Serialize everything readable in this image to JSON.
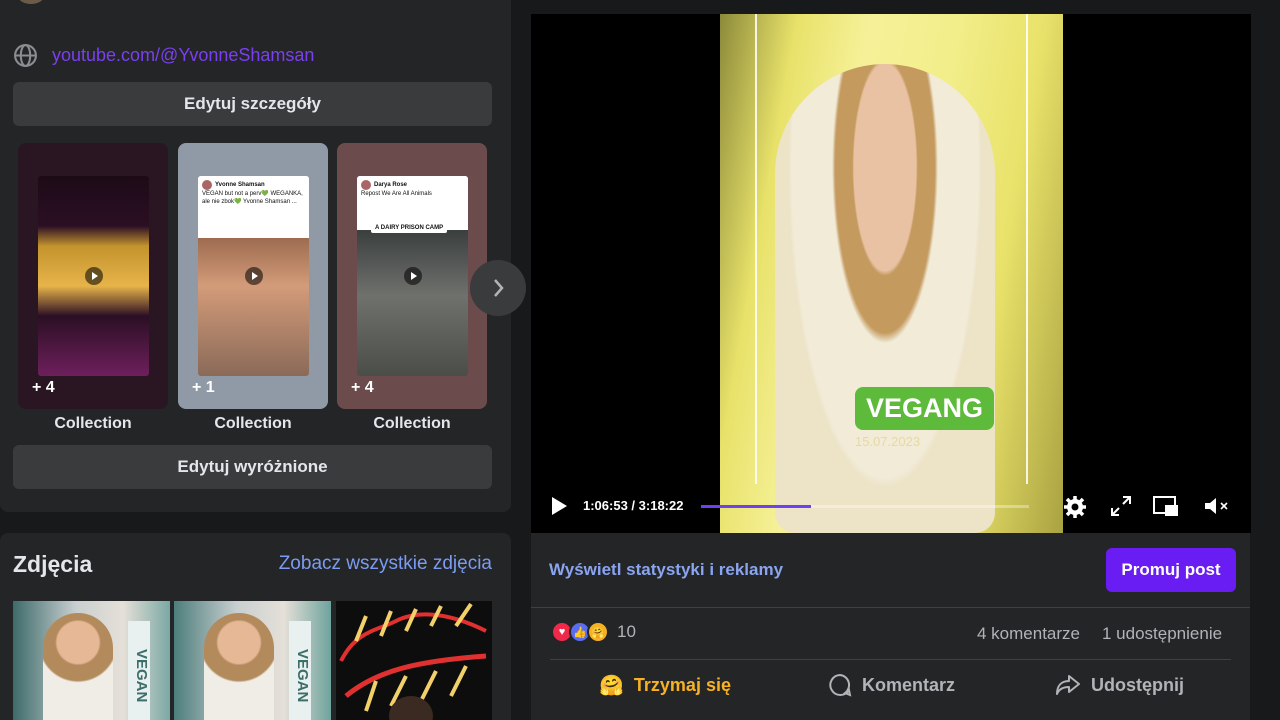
{
  "profile": {
    "website": "youtube.com/@YvonneShamsan",
    "edit_details_label": "Edytuj szczegóły",
    "edit_featured_label": "Edytuj wyróżnione",
    "collections": [
      {
        "label": "Collection",
        "count": "+ 4"
      },
      {
        "label": "Collection",
        "count": "+ 1",
        "post_author": "Yvonne Shamsan",
        "post_text": "VEGAN but not a perv💚 WEGANKA, ale nie zbok💚 Yvonne Shamsan ..."
      },
      {
        "label": "Collection",
        "count": "+ 4",
        "post_author": "Darya Rose",
        "post_text": "Repost We Are All Animals",
        "overlay": "A DAIRY PRISON CAMP"
      }
    ]
  },
  "photos": {
    "title": "Zdjęcia",
    "see_all_label": "Zobacz wszystkie zdjęcia",
    "vegan_text": "VEGAN"
  },
  "video": {
    "overlay_text": "VEGANG",
    "overlay_date": "15.07.2023",
    "current_time": "1:06:53",
    "duration": "3:18:22",
    "progress_fraction": 0.336
  },
  "post_actions": {
    "stats_label": "Wyświetl statystyki i reklamy",
    "promote_label": "Promuj post",
    "reaction_count": "10",
    "comments_label": "4 komentarze",
    "shares_label": "1 udostępnienie",
    "care_label": "Trzymaj się",
    "comment_label": "Komentarz",
    "share_label": "Udostępnij"
  },
  "colors": {
    "accent_purple": "#6a1df3",
    "link_blue": "#8aa4ef",
    "vegang_green": "#5dba3a"
  }
}
